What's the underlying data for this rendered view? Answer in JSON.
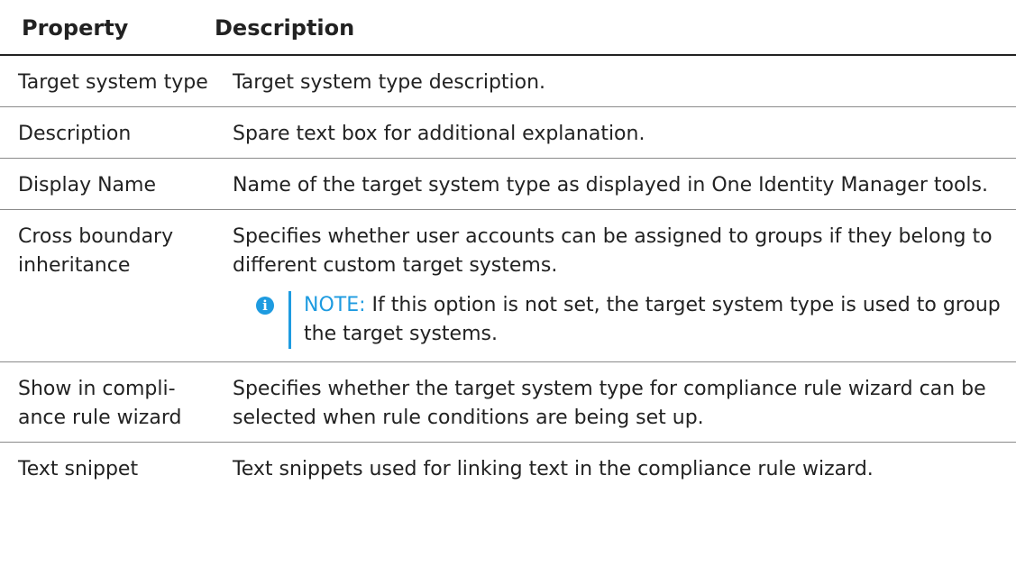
{
  "header": {
    "property": "Property",
    "description": "Description"
  },
  "rows": [
    {
      "property": "Target system type",
      "description": "Target system type description."
    },
    {
      "property": "Description",
      "description": "Spare text box for additional explanation."
    },
    {
      "property": "Display Name",
      "description": "Name of the target system type as displayed in One Identity Manager tools."
    },
    {
      "property": "Cross boundary inheritance",
      "description": "Specifies whether user accounts can be assigned to groups if they belong to different custom target systems.",
      "note": {
        "label": "NOTE:",
        "text": " If this option is not set, the target system type is used to group the target systems."
      }
    },
    {
      "property": "Show in compli-ance rule wizard",
      "description": "Specifies whether the target system type for compliance rule wizard can be selected when rule conditions are being set up."
    },
    {
      "property": "Text snippet",
      "description": "Text snippets used for linking text in the compliance rule wizard."
    }
  ],
  "colors": {
    "note_accent": "#1e9be0",
    "text": "#222222",
    "row_divider": "#8a8a8a"
  },
  "icons": {
    "note": "info-icon"
  }
}
